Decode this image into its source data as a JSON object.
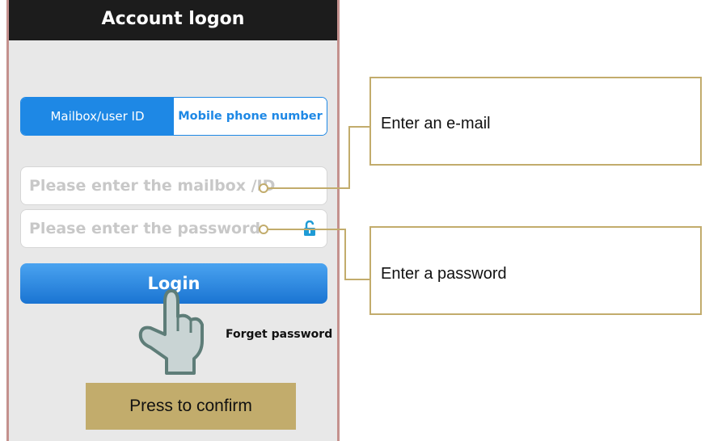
{
  "header": {
    "title": "Account logon"
  },
  "tabs": [
    {
      "label": "Mailbox/user ID",
      "active": true
    },
    {
      "label": "Mobile phone number",
      "active": false
    }
  ],
  "form": {
    "email_placeholder": "Please enter the mailbox /ID",
    "password_placeholder": "Please enter the password",
    "login_label": "Login",
    "forget_label": "Forget password"
  },
  "annotations": {
    "email_note": "Enter an e-mail",
    "password_note": "Enter a password",
    "confirm_note": "Press to confirm"
  },
  "colors": {
    "accent": "#1e88e5",
    "callout_gold": "#c2ac6c",
    "title_bar": "#1c1c1c",
    "phone_border": "#c4918e"
  },
  "icons": [
    "lock-open-icon",
    "pointing-hand-icon"
  ]
}
